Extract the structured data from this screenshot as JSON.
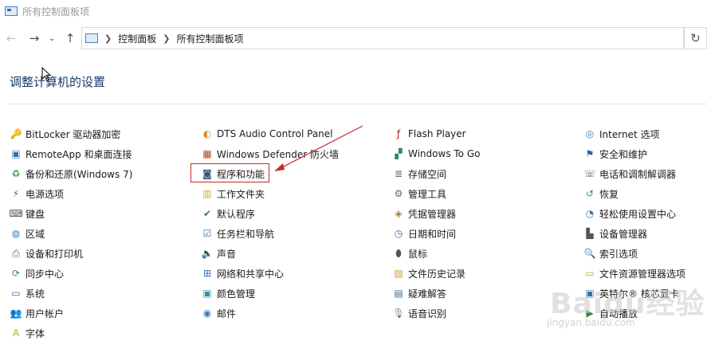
{
  "window": {
    "title": "所有控制面板项"
  },
  "breadcrumb": {
    "items": [
      "控制面板",
      "所有控制面板项"
    ]
  },
  "page": {
    "title": "调整计算机的设置"
  },
  "items": {
    "col1": [
      {
        "label": "BitLocker 驱动器加密",
        "icon": "bitlocker-icon",
        "glyph": "🔑",
        "color": "#c8a030"
      },
      {
        "label": "RemoteApp 和桌面连接",
        "icon": "remoteapp-icon",
        "glyph": "▣",
        "color": "#2f6fb5"
      },
      {
        "label": "备份和还原(Windows 7)",
        "icon": "backup-icon",
        "glyph": "♻",
        "color": "#3a9a3a"
      },
      {
        "label": "电源选项",
        "icon": "power-options-icon",
        "glyph": "⚡",
        "color": "#3a8a3a"
      },
      {
        "label": "键盘",
        "icon": "keyboard-icon",
        "glyph": "⌨",
        "color": "#555555"
      },
      {
        "label": "区域",
        "icon": "region-icon",
        "glyph": "◍",
        "color": "#2f7fc5"
      },
      {
        "label": "设备和打印机",
        "icon": "printer-icon",
        "glyph": "⎙",
        "color": "#4a6a8a"
      },
      {
        "label": "同步中心",
        "icon": "sync-icon",
        "glyph": "⟳",
        "color": "#2e9a3e"
      },
      {
        "label": "系统",
        "icon": "system-icon",
        "glyph": "▭",
        "color": "#2f6fb5"
      },
      {
        "label": "用户帐户",
        "icon": "user-accounts-icon",
        "glyph": "👥",
        "color": "#4a7ab5"
      },
      {
        "label": "字体",
        "icon": "fonts-icon",
        "glyph": "A",
        "color": "#c8a030"
      }
    ],
    "col2": [
      {
        "label": "DTS Audio Control Panel",
        "icon": "dts-audio-icon",
        "glyph": "◐",
        "color": "#e08a30"
      },
      {
        "label": "Windows Defender 防火墙",
        "icon": "firewall-icon",
        "glyph": "▦",
        "color": "#a04a30"
      },
      {
        "label": "程序和功能",
        "icon": "programs-features-icon",
        "glyph": "◙",
        "color": "#3a5a7a"
      },
      {
        "label": "工作文件夹",
        "icon": "work-folders-icon",
        "glyph": "▥",
        "color": "#d8a830"
      },
      {
        "label": "默认程序",
        "icon": "default-programs-icon",
        "glyph": "✔",
        "color": "#2e8a3e"
      },
      {
        "label": "任务栏和导航",
        "icon": "taskbar-icon",
        "glyph": "☑",
        "color": "#3a6a9a"
      },
      {
        "label": "声音",
        "icon": "sound-icon",
        "glyph": "🔈",
        "color": "#777777"
      },
      {
        "label": "网络和共享中心",
        "icon": "network-icon",
        "glyph": "⊞",
        "color": "#2f6fb5"
      },
      {
        "label": "颜色管理",
        "icon": "color-management-icon",
        "glyph": "▣",
        "color": "#2f8fa5"
      },
      {
        "label": "邮件",
        "icon": "mail-icon",
        "glyph": "◉",
        "color": "#3a7ab5"
      }
    ],
    "col3": [
      {
        "label": "Flash Player",
        "icon": "flash-player-icon",
        "glyph": "ƒ",
        "color": "#b02020"
      },
      {
        "label": "Windows To Go",
        "icon": "windows-to-go-icon",
        "glyph": "▞",
        "color": "#2e8a5e"
      },
      {
        "label": "存储空间",
        "icon": "storage-spaces-icon",
        "glyph": "≣",
        "color": "#666666"
      },
      {
        "label": "管理工具",
        "icon": "admin-tools-icon",
        "glyph": "⚙",
        "color": "#666666"
      },
      {
        "label": "凭据管理器",
        "icon": "credential-manager-icon",
        "glyph": "◈",
        "color": "#b08030"
      },
      {
        "label": "日期和时间",
        "icon": "date-time-icon",
        "glyph": "◷",
        "color": "#3a6a9a"
      },
      {
        "label": "鼠标",
        "icon": "mouse-icon",
        "glyph": "⬮",
        "color": "#555555"
      },
      {
        "label": "文件历史记录",
        "icon": "file-history-icon",
        "glyph": "▨",
        "color": "#c8a030"
      },
      {
        "label": "疑难解答",
        "icon": "troubleshooting-icon",
        "glyph": "▤",
        "color": "#3a6a9a"
      },
      {
        "label": "语音识别",
        "icon": "speech-recognition-icon",
        "glyph": "🎙",
        "color": "#777777"
      }
    ],
    "col4": [
      {
        "label": "Internet 选项",
        "icon": "internet-options-icon",
        "glyph": "◎",
        "color": "#2f7fc5"
      },
      {
        "label": "安全和维护",
        "icon": "security-maintenance-icon",
        "glyph": "⚑",
        "color": "#2f5fb5"
      },
      {
        "label": "电话和调制解调器",
        "icon": "phone-modem-icon",
        "glyph": "☏",
        "color": "#555555"
      },
      {
        "label": "恢复",
        "icon": "recovery-icon",
        "glyph": "↺",
        "color": "#2e9a4e"
      },
      {
        "label": "轻松使用设置中心",
        "icon": "ease-of-access-icon",
        "glyph": "◔",
        "color": "#2f6fb5"
      },
      {
        "label": "设备管理器",
        "icon": "device-manager-icon",
        "glyph": "▙",
        "color": "#555555"
      },
      {
        "label": "索引选项",
        "icon": "indexing-options-icon",
        "glyph": "🔍",
        "color": "#666666"
      },
      {
        "label": "文件资源管理器选项",
        "icon": "file-explorer-options-icon",
        "glyph": "▭",
        "color": "#c8a030"
      },
      {
        "label": "英特尔® 核芯显卡",
        "icon": "intel-graphics-icon",
        "glyph": "▣",
        "color": "#2f6fb5"
      },
      {
        "label": "自动播放",
        "icon": "autoplay-icon",
        "glyph": "▶",
        "color": "#2e8a3e"
      }
    ]
  },
  "watermark": {
    "text": "Baidu经验",
    "sub": "jingyan.baidu.com"
  },
  "colors": {
    "highlight": "#c62828",
    "title": "#1b3a6b"
  }
}
